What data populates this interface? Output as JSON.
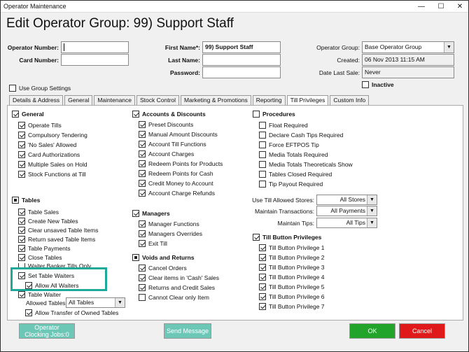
{
  "window": {
    "title": "Operator Maintenance",
    "min": "—",
    "max": "☐",
    "close": "✕"
  },
  "heading": "Edit Operator Group: 99) Support Staff",
  "form": {
    "operator_number_label": "Operator Number:",
    "operator_number": "",
    "card_number_label": "Card Number:",
    "card_number": "",
    "first_name_label": "First Name*:",
    "first_name": "99) Support Staff",
    "last_name_label": "Last Name:",
    "last_name": "",
    "password_label": "Password:",
    "password": "",
    "operator_group_label": "Operator Group:",
    "operator_group": "Base Operator Group",
    "created_label": "Created:",
    "created": "06 Nov 2013 11:15 AM",
    "date_last_sale_label": "Date Last Sale:",
    "date_last_sale": "Never",
    "inactive_label": "Inactive",
    "use_group_settings_label": "Use Group Settings"
  },
  "tabs": [
    "Details & Address",
    "General",
    "Maintenance",
    "Stock Control",
    "Marketing & Promotions",
    "Reporting",
    "Till Privileges",
    "Custom Info"
  ],
  "general": {
    "title": "General",
    "items": [
      "Operate Tills",
      "Compulsory Tendering",
      "'No Sales' Allowed",
      "Card Authorizations",
      "Multiple Sales on Hold",
      "Stock Functions at Till"
    ]
  },
  "tables": {
    "title": "Tables",
    "items": [
      "Table Sales",
      "Create New Tables",
      "Clear unsaved Table Items",
      "Return saved Table Items",
      "Table Payments",
      "Close Tables",
      "Waiter Banker Tills Only",
      "Set Table Waiters",
      "Allow All Waiters",
      "Table Waiter"
    ],
    "allowed_tables_label": "Allowed Tables:",
    "allowed_tables_value": "All Tables",
    "allow_transfer": "Allow Transfer of Owned Tables"
  },
  "accounts": {
    "title": "Accounts & Discounts",
    "items": [
      "Preset Discounts",
      "Manual Amount Discounts",
      "Account Till Functions",
      "Account Charges",
      "Redeem Points for Products",
      "Redeem Points for Cash",
      "Credit Money to Account",
      "Account Charge Refunds"
    ]
  },
  "managers": {
    "title": "Managers",
    "items": [
      "Manager Functions",
      "Managers Overrides",
      "Exit Till"
    ]
  },
  "voids": {
    "title": "Voids and Returns",
    "items": [
      "Cancel Orders",
      "Clear items in 'Cash' Sales",
      "Returns and Credit Sales",
      "Cannot Clear only Item"
    ]
  },
  "procedures": {
    "title": "Procedures",
    "items": [
      "Float Required",
      "Declare Cash Tips Required",
      "Force EFTPOS Tip",
      "Media Totals Required",
      "Media Totals Theoreticals Show",
      "Tables Closed Required",
      "Tip Payout Required"
    ]
  },
  "allowed": {
    "stores_label": "Use Till Allowed Stores:",
    "stores": "All Stores",
    "transactions_label": "Maintain Transactions:",
    "transactions": "All Payments",
    "tips_label": "Maintain Tips:",
    "tips": "All Tips"
  },
  "till_button": {
    "title": "Till Button Privileges",
    "items": [
      "Till Button Privilege 1",
      "Till Button Privilege 2",
      "Till Button Privilege 3",
      "Till Button Privilege 4",
      "Till Button Privilege 5",
      "Till Button Privilege 6",
      "Till Button Privilege 7"
    ]
  },
  "buttons": {
    "operator_clocking": "Operator\nClocking Jobs:0",
    "send_message": "Send Message",
    "ok": "OK",
    "cancel": "Cancel"
  },
  "colors": {
    "teal": "#6cc7b7",
    "ok_green": "#22a32a",
    "cancel_red": "#e01a1a",
    "highlight": "#1fa99a"
  }
}
